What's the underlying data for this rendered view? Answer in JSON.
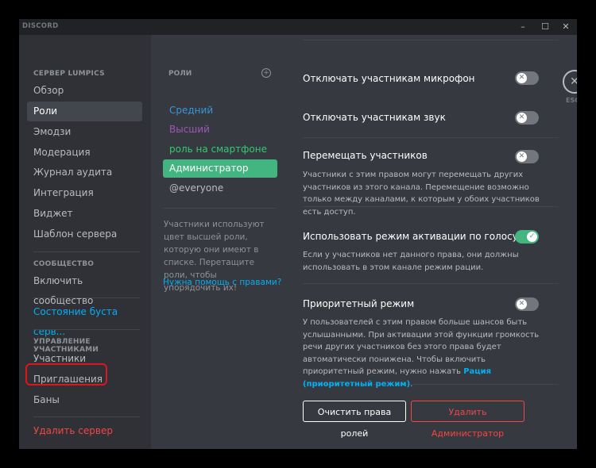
{
  "app": {
    "logo": "DISCORD",
    "min": "–",
    "max": "☐",
    "close": "✕"
  },
  "sidebar": {
    "section1": "СЕРВЕР LUMPICS",
    "items1": [
      "Обзор",
      "Роли",
      "Эмодзи",
      "Модерация",
      "Журнал аудита",
      "Интеграция",
      "Виджет",
      "Шаблон сервера"
    ],
    "section2": "СООБЩЕСТВО",
    "community": "Включить сообщество",
    "boost": "Состояние буста серв...",
    "section3": "УПРАВЛЕНИЕ УЧАСТНИКАМИ",
    "members": "Участники",
    "invites": "Приглашения",
    "bans": "Баны",
    "delete": "Удалить сервер"
  },
  "roles": {
    "header": "РОЛИ",
    "add": "+",
    "list": [
      {
        "name": "Средний",
        "color": "#3498db"
      },
      {
        "name": "Высший",
        "color": "#9b59b6"
      },
      {
        "name": "роль на смартфоне",
        "color": "#2ecc71"
      },
      {
        "name": "Администратор",
        "color": "#ffffff"
      },
      {
        "name": "@everyone",
        "color": "#b9bbbe"
      }
    ],
    "selected": "Администратор",
    "description": "Участники используют цвет высшей роли, которую они имеют в списке. Перетащите роли, чтобы упорядочить их!",
    "help": "Нужна помощь с правами?"
  },
  "permissions": [
    {
      "title": "Отключать участникам микрофон",
      "desc": "",
      "on": false
    },
    {
      "title": "Отключать участникам звук",
      "desc": "",
      "on": false
    },
    {
      "title": "Перемещать участников",
      "desc": "Участники с этим правом могут перемещать других участников из этого канала. Перемещение возможно только между каналами, к которым у обоих участников есть доступ.",
      "on": false
    },
    {
      "title": "Использовать режим активации по голосу",
      "desc": "Если у участников нет данного права, они должны использовать в этом канале режим рации.",
      "on": true
    },
    {
      "title": "Приоритетный режим",
      "desc": "У пользователей с этим правом больше шансов быть услышанными. При активации этой функции громкость речи других участников без этого права будет автоматически понижена. Чтобы включить приоритетный режим, нужно нажать",
      "desc_link": "Рация (приоритетный режим)",
      "desc_end": ".",
      "on": false
    }
  ],
  "toggle_icons": {
    "off": "✕",
    "on": "✓"
  },
  "buttons": {
    "clear": "Очистить права ролей",
    "delete_role": "Удалить Администратор"
  },
  "esc": {
    "icon": "✕",
    "label": "ESC"
  },
  "colors": {
    "accent": "#00b0f4",
    "danger": "#f04747",
    "green": "#43b581",
    "highlight": "#e0151c"
  }
}
